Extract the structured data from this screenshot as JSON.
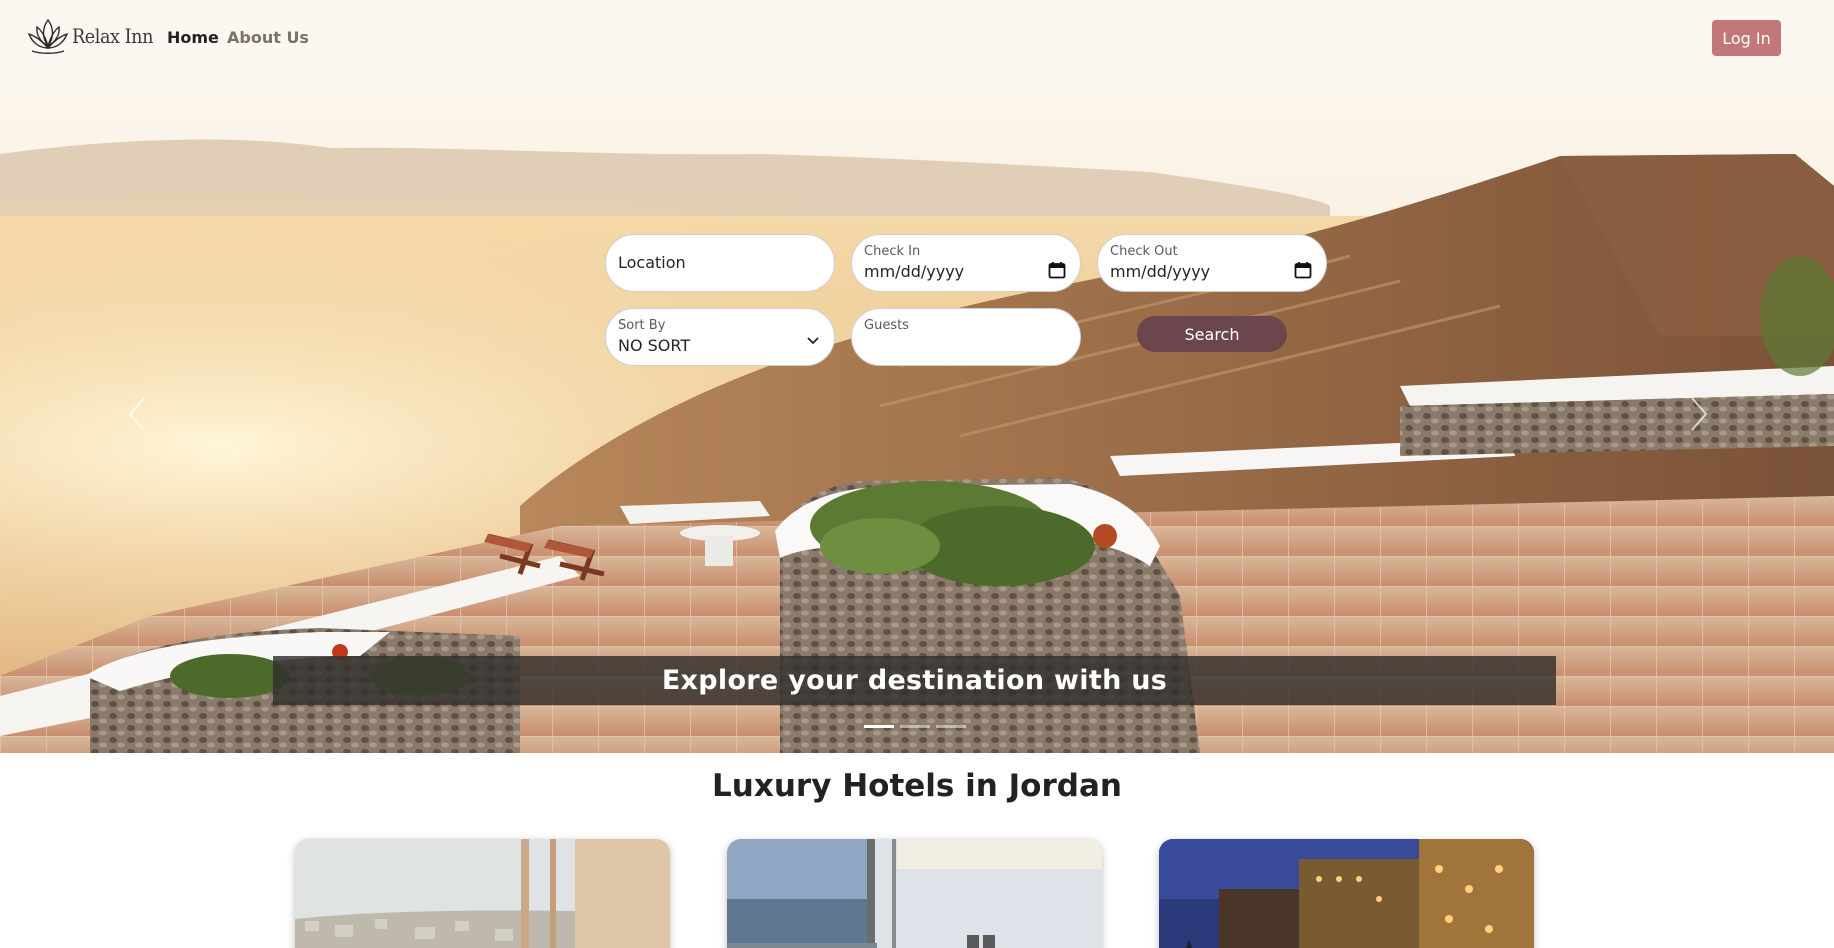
{
  "navbar": {
    "brand_name": "Relax Inn",
    "links": [
      {
        "label": "Home",
        "active": true
      },
      {
        "label": "About Us",
        "active": false
      }
    ],
    "login_label": "Log In"
  },
  "search": {
    "location_placeholder": "Location",
    "check_in_label": "Check In",
    "check_in_value": "mm/dd/yyyy",
    "check_out_label": "Check Out",
    "check_out_value": "mm/dd/yyyy",
    "sort_label": "Sort By",
    "sort_value": "NO SORT",
    "guests_label": "Guests",
    "search_label": "Search"
  },
  "hero": {
    "caption": "Explore your destination with us",
    "slide_count": 3,
    "active_slide": 1
  },
  "section": {
    "title": "Luxury Hotels in Jordan"
  },
  "colors": {
    "navbar_bg": "#fcf8f1",
    "login_button": "#c27878",
    "search_button": "#6b474d",
    "caption_bg": "#322f2d"
  },
  "icons": {
    "logo": "lotus-logo-icon",
    "calendar": "calendar-icon",
    "dropdown": "chevron-down-icon",
    "prev": "chevron-left-icon",
    "next": "chevron-right-icon"
  }
}
